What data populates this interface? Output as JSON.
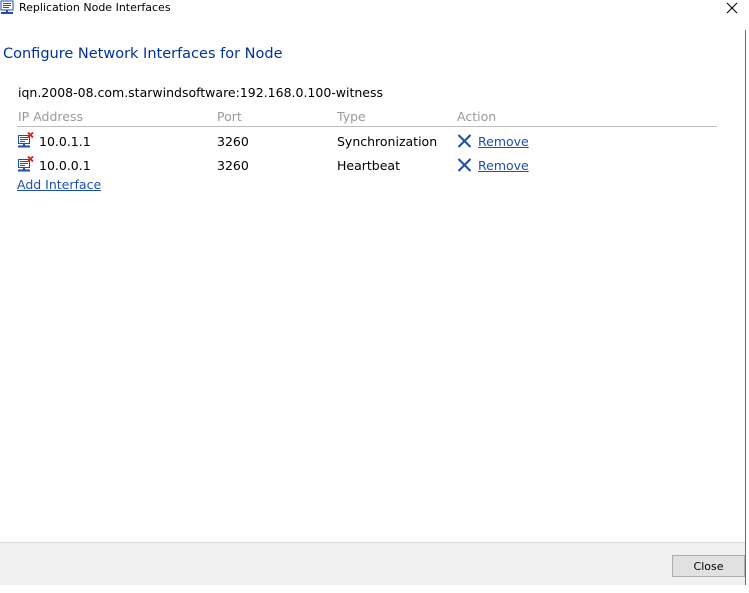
{
  "window": {
    "title": "Replication Node Interfaces"
  },
  "heading": "Configure Network Interfaces for Node",
  "node_name": "iqn.2008-08.com.starwindsoftware:192.168.0.100-witness",
  "table": {
    "columns": [
      "IP Address",
      "Port",
      "Type",
      "Action"
    ],
    "rows": [
      {
        "ip": "10.0.1.1",
        "port": "3260",
        "type": "Synchronization",
        "action": "Remove"
      },
      {
        "ip": "10.0.0.1",
        "port": "3260",
        "type": "Heartbeat",
        "action": "Remove"
      }
    ]
  },
  "add_interface_label": "Add Interface",
  "footer": {
    "close_label": "Close"
  },
  "colors": {
    "heading": "#003399",
    "link": "#1e4fb0",
    "remove_x": "#1f4fa8",
    "header_text": "#9a9a9a"
  }
}
